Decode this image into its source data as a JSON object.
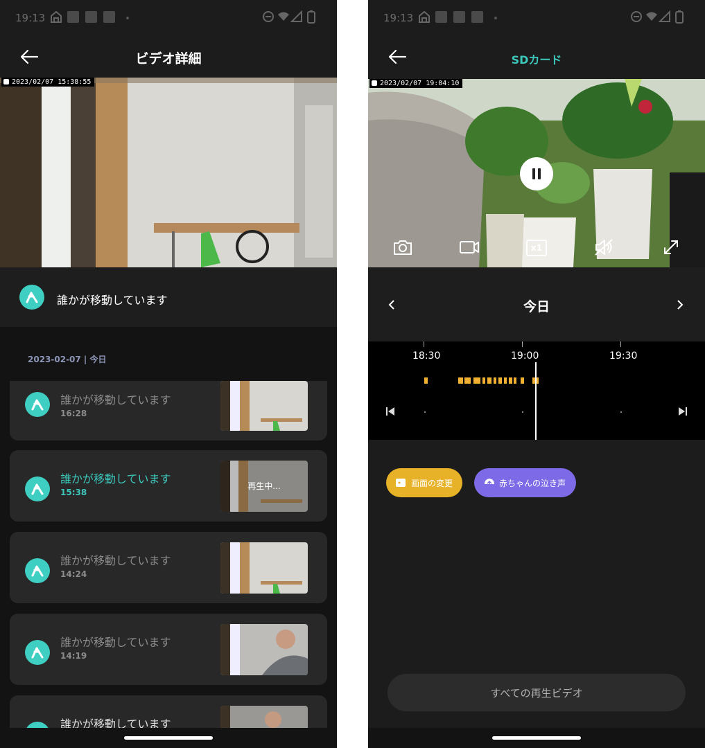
{
  "left": {
    "status_time": "19:13",
    "title": "ビデオ詳細",
    "camera_timestamp": "2023/02/07  15:38:55",
    "event_banner": "誰かが移動しています",
    "date_header": "2023-02-07 | 今日",
    "events": [
      {
        "title": "誰かが移動しています",
        "time": "16:28"
      },
      {
        "title": "誰かが移動しています",
        "time": "15:38",
        "overlay": "再生中..."
      },
      {
        "title": "誰かが移動しています",
        "time": "14:24"
      },
      {
        "title": "誰かが移動しています",
        "time": "14:19"
      },
      {
        "title": "誰かが移動しています",
        "time": ""
      }
    ]
  },
  "right": {
    "status_time": "19:13",
    "title": "SDカード",
    "camera_timestamp": "2023/02/07  19:04:10",
    "controls": {
      "speed": "x1"
    },
    "day": "今日",
    "timeline": {
      "tick_labels": [
        "18:30",
        "19:00",
        "19:30"
      ]
    },
    "tags": [
      {
        "label": "画面の変更",
        "color": "#e8b228"
      },
      {
        "label": "赤ちゃんの泣き声",
        "color": "#7d6ae6"
      }
    ],
    "all_videos_button": "すべての再生ビデオ"
  },
  "colors": {
    "accent": "#3cc8bb",
    "background": "#1c1c1c",
    "card": "#282828",
    "timeline_event": "#f0b030"
  }
}
